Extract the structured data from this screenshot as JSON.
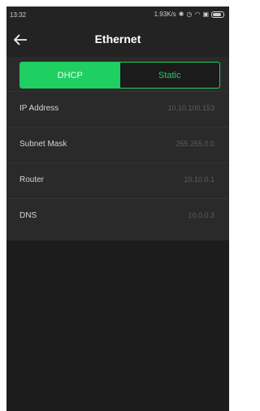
{
  "status_bar": {
    "time": "13:32",
    "net_speed": "1.93K/s",
    "icons": [
      "bluetooth-icon",
      "alarm-icon",
      "wifi-icon",
      "sim-icon",
      "battery-icon"
    ]
  },
  "app_bar": {
    "back_icon": "arrow-left-icon",
    "title": "Ethernet"
  },
  "mode_toggle": {
    "options": [
      "DHCP",
      "Static"
    ],
    "selected": "DHCP"
  },
  "fields": [
    {
      "label": "IP Address",
      "value": "10.10.100.153"
    },
    {
      "label": "Subnet Mask",
      "value": "255.255.0.0"
    },
    {
      "label": "Router",
      "value": "10.10.0.1"
    },
    {
      "label": "DNS",
      "value": "10.0.0.3"
    }
  ],
  "colors": {
    "accent": "#1fcf62",
    "background": "#1c1c1c",
    "panel": "#2a2a2a"
  }
}
